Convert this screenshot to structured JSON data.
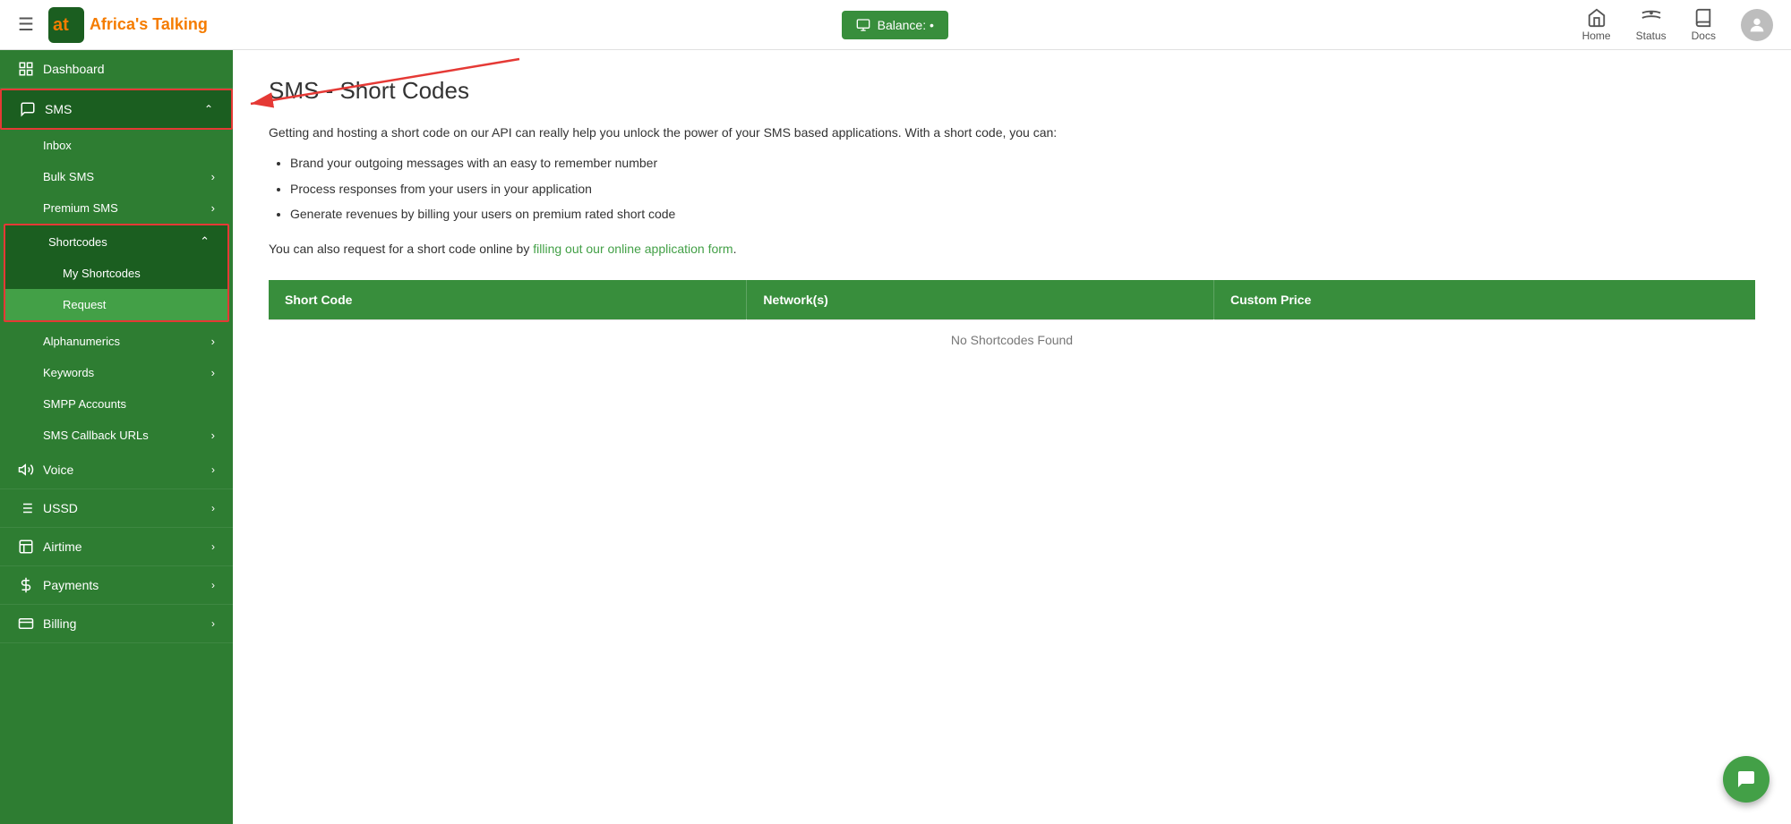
{
  "header": {
    "hamburger_label": "☰",
    "logo_text": "Africa's Talking",
    "balance_label": "Balance: •",
    "nav": [
      {
        "id": "home",
        "label": "Home",
        "icon": "home-icon"
      },
      {
        "id": "status",
        "label": "Status",
        "icon": "status-icon"
      },
      {
        "id": "docs",
        "label": "Docs",
        "icon": "docs-icon"
      }
    ]
  },
  "sidebar": {
    "items": [
      {
        "id": "dashboard",
        "label": "Dashboard",
        "icon": "dashboard-icon",
        "has_chevron": false
      },
      {
        "id": "sms",
        "label": "SMS",
        "icon": "sms-icon",
        "has_chevron": true,
        "active": true,
        "expanded": true,
        "sub_items": [
          {
            "id": "inbox",
            "label": "Inbox"
          },
          {
            "id": "bulk-sms",
            "label": "Bulk SMS",
            "has_chevron": true
          },
          {
            "id": "premium-sms",
            "label": "Premium SMS",
            "has_chevron": true
          },
          {
            "id": "shortcodes",
            "label": "Shortcodes",
            "has_chevron": true,
            "expanded": true,
            "sub_items": [
              {
                "id": "my-shortcodes",
                "label": "My Shortcodes"
              },
              {
                "id": "request",
                "label": "Request"
              }
            ]
          },
          {
            "id": "alphanumerics",
            "label": "Alphanumerics",
            "has_chevron": true
          },
          {
            "id": "keywords",
            "label": "Keywords",
            "has_chevron": true
          },
          {
            "id": "smpp-accounts",
            "label": "SMPP Accounts"
          },
          {
            "id": "sms-callback-urls",
            "label": "SMS Callback URLs",
            "has_chevron": true
          }
        ]
      },
      {
        "id": "voice",
        "label": "Voice",
        "icon": "voice-icon",
        "has_chevron": true
      },
      {
        "id": "ussd",
        "label": "USSD",
        "icon": "ussd-icon",
        "has_chevron": true
      },
      {
        "id": "airtime",
        "label": "Airtime",
        "icon": "airtime-icon",
        "has_chevron": true
      },
      {
        "id": "payments",
        "label": "Payments",
        "icon": "payments-icon",
        "has_chevron": true
      },
      {
        "id": "billing",
        "label": "Billing",
        "icon": "billing-icon",
        "has_chevron": true
      }
    ]
  },
  "page": {
    "title": "SMS - Short Codes",
    "intro": "Getting and hosting a short code on our API can really help you unlock the power of your SMS based applications. With a short code, you can:",
    "bullets": [
      "Brand your outgoing messages with an easy to remember number",
      "Process responses from your users in your application",
      "Generate revenues by billing your users on premium rated short code"
    ],
    "request_text_before": "You can also request for a short code online by ",
    "request_link": "filling out our online application form",
    "request_text_after": ".",
    "table": {
      "headers": [
        "Short Code",
        "Network(s)",
        "Custom Price"
      ],
      "empty_message": "No Shortcodes Found"
    }
  },
  "colors": {
    "green_dark": "#1b5e20",
    "green_medium": "#2e7d32",
    "green_light": "#388e3c",
    "green_accent": "#43a047",
    "red": "#e53935",
    "orange": "#f57c00"
  }
}
